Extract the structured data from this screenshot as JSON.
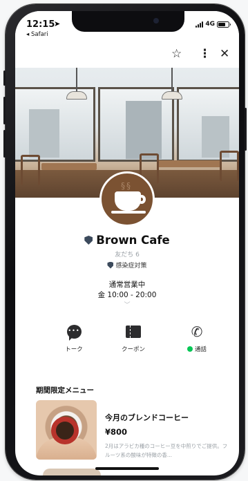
{
  "status_bar": {
    "time": "12:15",
    "back_app": "◂ Safari",
    "network": "4G"
  },
  "top_bar": {
    "favorite_icon": "star-icon",
    "more_icon": "more-vertical-icon",
    "close_icon": "close-icon"
  },
  "profile": {
    "name": "Brown Cafe",
    "friends": "友だち 6",
    "badge": "感染症対策",
    "status": "通常営業中",
    "hours": "金 10:00 - 20:00"
  },
  "actions": [
    {
      "label": "トーク",
      "icon": "chat-bubble-icon"
    },
    {
      "label": "クーポン",
      "icon": "coupon-icon"
    },
    {
      "label": "通話",
      "icon": "phone-icon"
    }
  ],
  "section": {
    "title": "期間限定メニュー"
  },
  "menu_item": {
    "title": "今月のブレンドコーヒー",
    "price": "¥800",
    "description": "2月はアラビカ種のコーヒー豆を中煎りでご提供。フルーツ系の酸味が特徴の香..."
  },
  "colors": {
    "accent_green": "#06c755",
    "avatar_brown": "#7b5232",
    "shield": "#3c4a5c"
  }
}
